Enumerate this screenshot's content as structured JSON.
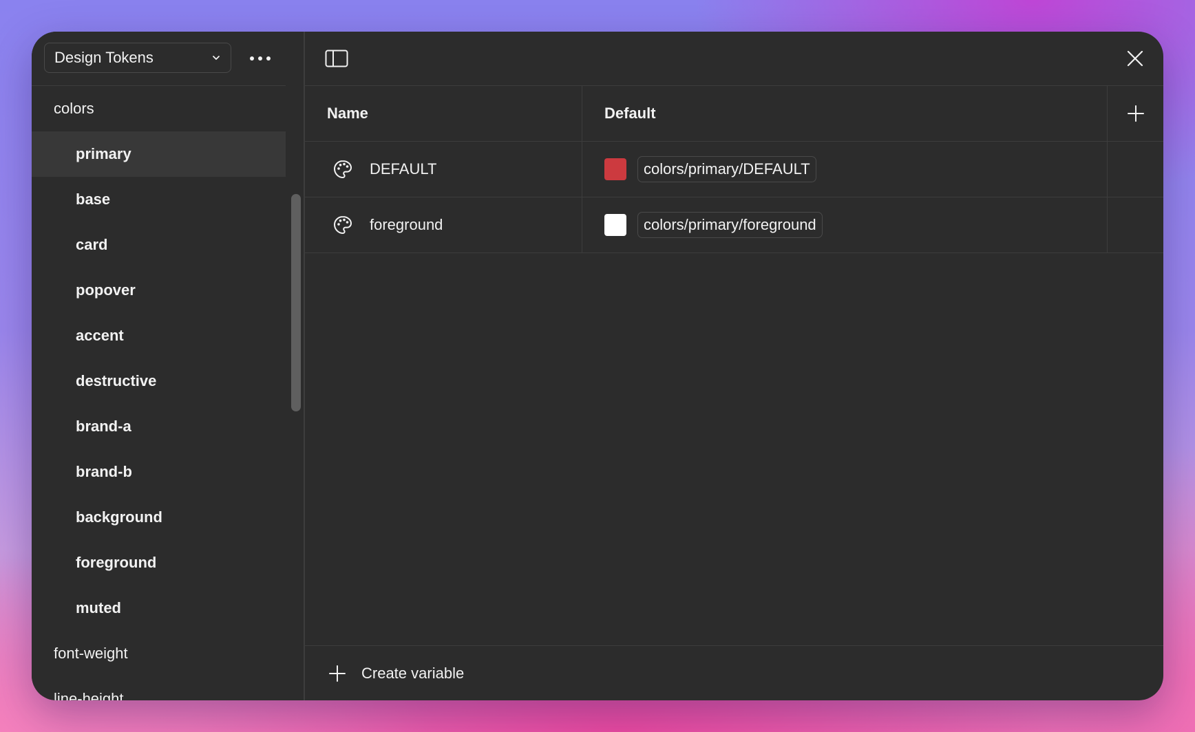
{
  "sidebar": {
    "collection_label": "Design Tokens",
    "tree": [
      {
        "label": "colors",
        "level": "group",
        "selected": false
      },
      {
        "label": "primary",
        "level": "child",
        "selected": true
      },
      {
        "label": "base",
        "level": "child",
        "selected": false
      },
      {
        "label": "card",
        "level": "child",
        "selected": false
      },
      {
        "label": "popover",
        "level": "child",
        "selected": false
      },
      {
        "label": "accent",
        "level": "child",
        "selected": false
      },
      {
        "label": "destructive",
        "level": "child",
        "selected": false
      },
      {
        "label": "brand-a",
        "level": "child",
        "selected": false
      },
      {
        "label": "brand-b",
        "level": "child",
        "selected": false
      },
      {
        "label": "background",
        "level": "child",
        "selected": false
      },
      {
        "label": "foreground",
        "level": "child",
        "selected": false
      },
      {
        "label": "muted",
        "level": "child",
        "selected": false
      },
      {
        "label": "font-weight",
        "level": "group",
        "selected": false
      },
      {
        "label": "line-height",
        "level": "group",
        "selected": false
      }
    ]
  },
  "table": {
    "headers": {
      "name": "Name",
      "default": "Default"
    },
    "rows": [
      {
        "name": "DEFAULT",
        "icon": "palette-icon",
        "swatch_color": "#cc3a3f",
        "reference": "colors/primary/DEFAULT"
      },
      {
        "name": "foreground",
        "icon": "palette-icon",
        "swatch_color": "#ffffff",
        "reference": "colors/primary/foreground"
      }
    ]
  },
  "footer": {
    "create_label": "Create variable"
  },
  "colors": {
    "window_bg": "#2c2c2c",
    "selected_bg": "#383838",
    "border": "#3d3d3d",
    "text": "#f2f2f2"
  }
}
